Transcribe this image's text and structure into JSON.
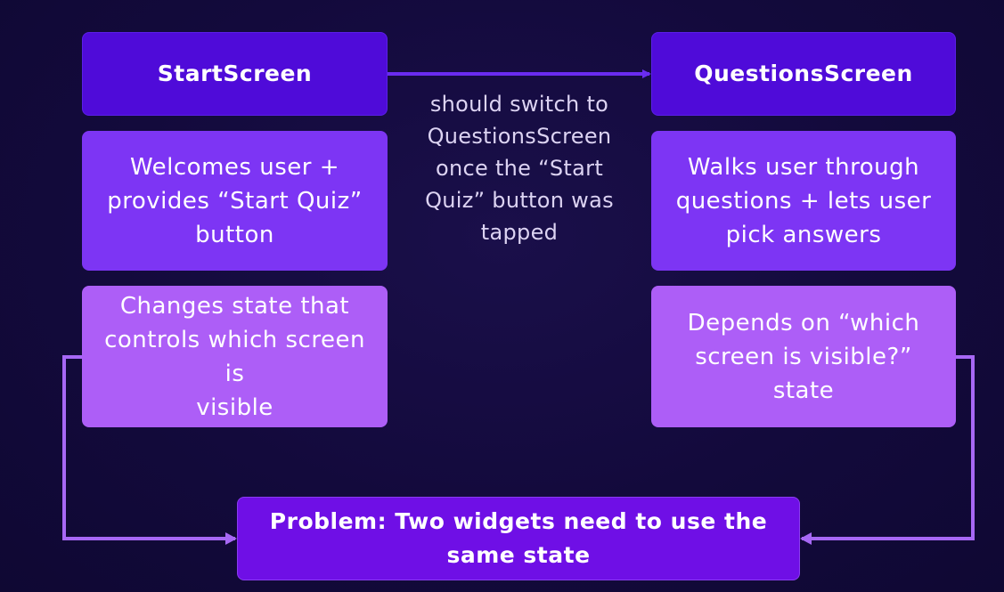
{
  "start_screen": {
    "title": "StartScreen",
    "description_lines": [
      "Welcomes user +",
      "provides “Start Quiz”",
      "button"
    ],
    "state_lines": [
      "Changes state that",
      "controls which screen is",
      "visible"
    ]
  },
  "questions_screen": {
    "title": "QuestionsScreen",
    "description_lines": [
      "Walks user through",
      "questions + lets user",
      "pick answers"
    ],
    "state_lines": [
      "Depends on “which",
      "screen is visible?” state"
    ]
  },
  "transition_label_lines": [
    "should switch to",
    "QuestionsScreen",
    "once the “Start",
    "Quiz” button was",
    "tapped"
  ],
  "problem": {
    "lines": [
      "Problem: Two widgets need to use the",
      "same state"
    ]
  },
  "colors": {
    "background": "#130a3c",
    "title_box": "#4f0bd9",
    "description_box": "#7d35f4",
    "state_box": "#ad5ef7",
    "problem_box": "#6f0fe6",
    "arrow_top": "#6a2cf0",
    "arrow_bottom": "#a768f5"
  }
}
